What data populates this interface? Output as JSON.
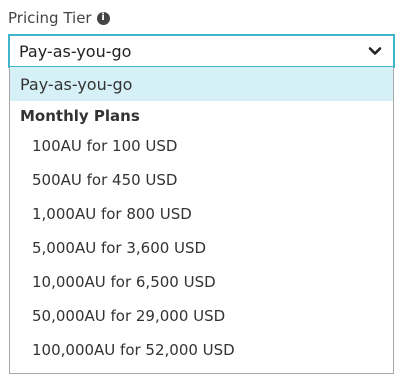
{
  "field": {
    "label": "Pricing Tier",
    "info_icon": "info-icon",
    "selected_value": "Pay-as-you-go",
    "chevron_icon": "chevron-down-icon"
  },
  "dropdown": {
    "selected_option": "Pay-as-you-go",
    "group_label": "Monthly Plans",
    "options": [
      "100AU for 100 USD",
      "500AU for 450 USD",
      "1,000AU for 800 USD",
      "5,000AU for 3,600 USD",
      "10,000AU for 6,500 USD",
      "50,000AU for 29,000 USD",
      "100,000AU for 52,000 USD"
    ]
  },
  "colors": {
    "focus_border": "#3fb5cc",
    "selected_bg": "#d6f0f7",
    "list_border": "#a8a8a8"
  }
}
